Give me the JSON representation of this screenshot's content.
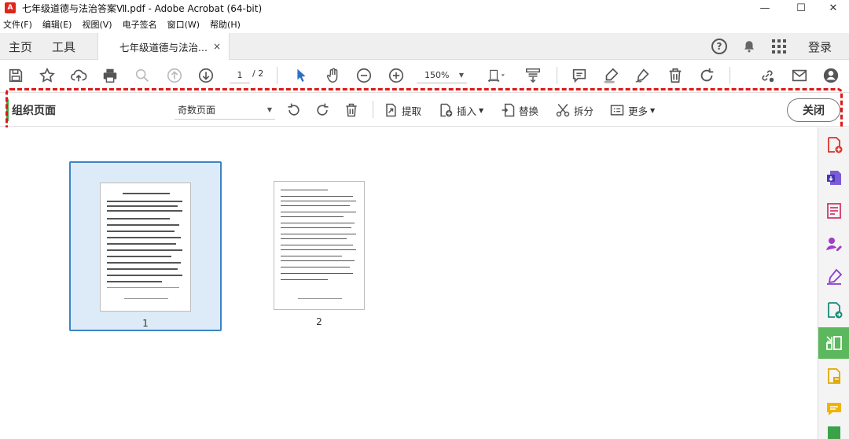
{
  "window": {
    "title": "七年级道德与法治答案Ⅶ.pdf - Adobe Acrobat (64-bit)",
    "minimize": "—",
    "maximize": "☐",
    "close": "✕"
  },
  "menu": [
    "文件(F)",
    "编辑(E)",
    "视图(V)",
    "电子签名",
    "窗口(W)",
    "帮助(H)"
  ],
  "tabs": {
    "home": "主页",
    "tools": "工具",
    "document": "七年级道德与法治...",
    "document_close": "×",
    "help": "?",
    "login": "登录"
  },
  "toolbar": {
    "current_page": "1",
    "total_pages": "/ 2",
    "zoom": "150%"
  },
  "organize": {
    "title": "组织页面",
    "page_filter": "奇数页面",
    "extract": "提取",
    "insert": "插入",
    "replace": "替换",
    "split": "拆分",
    "more": "更多",
    "close": "关闭"
  },
  "pages": [
    {
      "number": "1",
      "selected": true
    },
    {
      "number": "2",
      "selected": false
    }
  ],
  "colors": {
    "accent_red": "#e0261b",
    "selection_blue": "#3d84c6",
    "active_green": "#5cb85c",
    "highlight_dash": "#e01818"
  }
}
